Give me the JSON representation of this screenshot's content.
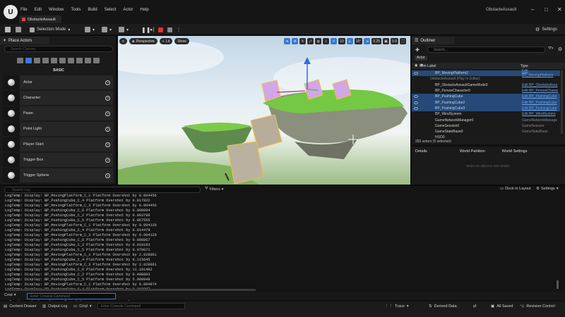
{
  "app": {
    "logo_glyph": "U",
    "project_tab": "ObstacleAssault",
    "project_title": "ObstacleAssault",
    "window_controls": [
      "–",
      "□",
      "✕"
    ]
  },
  "menu": [
    "File",
    "Edit",
    "Window",
    "Tools",
    "Build",
    "Select",
    "Actor",
    "Help"
  ],
  "toolbar": {
    "selection_mode": "Selection Mode",
    "settings": "Settings"
  },
  "place_actors": {
    "tab_label": "Place Actors",
    "search_placeholder": "Search Classes",
    "section_label": "BASIC",
    "items": [
      "Actor",
      "Character",
      "Pawn",
      "Point Light",
      "Player Start",
      "Trigger Box",
      "Trigger Sphere"
    ]
  },
  "viewport": {
    "perspective": "Perspective",
    "lit": "Lit",
    "show": "Show",
    "grid_snap": "10",
    "rot_snap": "10°",
    "scale_snap": "0.25",
    "cam_speed": "0.9"
  },
  "outliner": {
    "tab_label": "Outliner",
    "search_placeholder": "Search...",
    "actor_filter": "Actor",
    "col_label": "Item Label",
    "col_type": "Type",
    "rows": [
      {
        "name": "BP_MovingPlatform2",
        "type": "Edit BP_MovingPlatform",
        "sel": true,
        "link": true
      },
      {
        "name": "ObstacleAssault (Play In Editor)",
        "type": "",
        "sel": false,
        "link": false
      },
      {
        "name": "BP_ObstacleAssaultGameMode0",
        "type": "Edit BP_ObstacleAssa",
        "sel": false,
        "link": true
      },
      {
        "name": "BP_PersonCharacter0",
        "type": "Edit BP_PersonCharac",
        "sel": false,
        "link": true
      },
      {
        "name": "BP_PushingCube",
        "type": "Edit BP_PushingCube",
        "sel": true,
        "link": true
      },
      {
        "name": "BP_PushingCube2",
        "type": "Edit BP_PushingCube",
        "sel": true,
        "link": true
      },
      {
        "name": "BP_PushingCube3",
        "type": "Edit BP_PushingCube",
        "sel": true,
        "link": true
      },
      {
        "name": "BP_WindSystem",
        "type": "Edit BP_WindSystem",
        "sel": false,
        "link": true
      },
      {
        "name": "GameNetworkManager0",
        "type": "GameNetworkManage",
        "sel": false,
        "link": false
      },
      {
        "name": "GameSession0",
        "type": "GameSession",
        "sel": false,
        "link": false
      },
      {
        "name": "GameStateBase0",
        "type": "GameStateBase",
        "sel": false,
        "link": false
      },
      {
        "name": "HUD0",
        "type": "",
        "sel": false,
        "link": false
      }
    ],
    "count": "283 actors (5 selected)"
  },
  "details": {
    "tabs": [
      "Details",
      "World Partition",
      "World Settings"
    ],
    "empty_message": "Select an object to view details."
  },
  "log": {
    "search_placeholder": "Search Log",
    "filters": "Filters",
    "dock": "Dock in Layout",
    "settings": "Settings",
    "lines": [
      "LogTemp: Display: BP_MovingPlatform_C_1 Platform Overshot by 0.004456",
      "LogTemp: Display: BP_PushingCube_C_4 Platform Overshot by 0.017822",
      "LogTemp: Display: BP_MovingPlatform_C_3 Platform Overshot by 0.004456",
      "LogTemp: Display: BP_PushingCube_C_6 Platform Overshot by 0.009094",
      "LogTemp: Display: BP_PushingCube_C_2 Platform Overshot by 0.003799",
      "LogTemp: Display: BP_PushingCube_C_5 Platform Overshot by 0.067555",
      "LogTemp: Display: BP_MovingPlatform_C_1 Platform Overshot by 0.004120",
      "LogTemp: Display: BP_PushingCube_C_4 Platform Overshot by 0.014479",
      "LogTemp: Display: BP_MovingPlatform_C_3 Platform Overshot by 0.004120",
      "LogTemp: Display: BP_PushingCube_C_6 Platform Overshot by 0.008867",
      "LogTemp: Display: BP_PushingCube_C_2 Platform Overshot by 0.010193",
      "LogTemp: Display: BP_PushingCube_C_5 Platform Overshot by 0.070071",
      "LogTemp: Display: BP_MovingPlatform_C_1 Platform Overshot by 2.028961",
      "LogTemp: Display: BP_PushingCube_C_4 Platform Overshot by 0.115845",
      "LogTemp: Display: BP_MovingPlatform_C_3 Platform Overshot by 2.028961",
      "LogTemp: Display: BP_PushingCube_C_6 Platform Overshot by 11.181482",
      "LogTemp: Display: BP_PushingCube_C_2 Platform Overshot by 0.408803",
      "LogTemp: Display: BP_PushingCube_C_5 Platform Overshot by 5.009949",
      "LogTemp: Display: BP_MovingPlatform_C_1 Platform Overshot by 0.004974",
      "LogTemp: Display: BP_PushingCube_C_4 Platform Overshot by 0.018897",
      "LogTemp: Display: BP_MovingPlatform_C_3 Platform Overshot by 0.004974",
      "LogTemp: Display: BP_PushingCube_C_2 Platform Overshot by 0.010132",
      "LogTemp: Display: BP_PushingCube_C_5 Platform Overshot by 5.009644"
    ]
  },
  "cmd": {
    "label": "Cmd",
    "placeholder": "Enter Console Command"
  },
  "statusbar": {
    "content_drawer": "Content Drawer",
    "output_log": "Output Log",
    "cmd": "Cmd",
    "cmd_placeholder": "Enter Console Command",
    "trace": "Trace",
    "derived_data": "Derived Data",
    "all_saved": "All Saved",
    "revision_control": "Revision Control"
  }
}
